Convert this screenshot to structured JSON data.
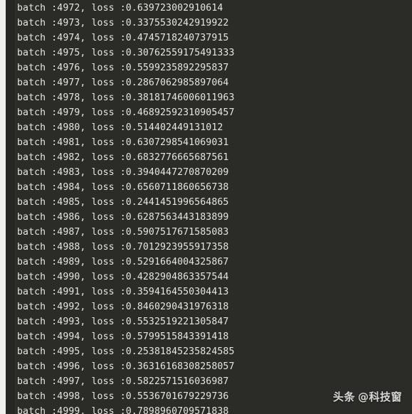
{
  "window": {
    "type": "terminal-console",
    "background_color": "#2b2b28",
    "text_color": "#e6e6e1",
    "margin_strip_color": "#f1f0ee",
    "gutter_color": "#262622"
  },
  "log": {
    "line_prefix": "batch :",
    "line_separator": ", loss :",
    "lines": [
      "batch :4972, loss :0.639723002910614",
      "batch :4973, loss :0.3375530242919922",
      "batch :4974, loss :0.4745718240737915",
      "batch :4975, loss :0.30762559175491333",
      "batch :4976, loss :0.5599235892295837",
      "batch :4977, loss :0.2867062985897064",
      "batch :4978, loss :0.38181746006011963",
      "batch :4979, loss :0.46892592310905457",
      "batch :4980, loss :0.514402449131012",
      "batch :4981, loss :0.6307298541069031",
      "batch :4982, loss :0.6832776665687561",
      "batch :4983, loss :0.3940447270870209",
      "batch :4984, loss :0.6560711860656738",
      "batch :4985, loss :0.2441451996564865",
      "batch :4986, loss :0.6287563443183899",
      "batch :4987, loss :0.5907517671585083",
      "batch :4988, loss :0.7012923955917358",
      "batch :4989, loss :0.5291664004325867",
      "batch :4990, loss :0.4282904863357544",
      "batch :4991, loss :0.3594164550304413",
      "batch :4992, loss :0.8460290431976318",
      "batch :4993, loss :0.5532519221305847",
      "batch :4994, loss :0.5799515843391418",
      "batch :4995, loss :0.25381845235824585",
      "batch :4996, loss :0.36316168308258057",
      "batch :4997, loss :0.5822571516036987",
      "batch :4998, loss :0.5536701679229736",
      "batch :4999, loss :0.7898960709571838"
    ],
    "entries": [
      {
        "batch": 4972,
        "loss": 0.639723002910614
      },
      {
        "batch": 4973,
        "loss": 0.3375530242919922
      },
      {
        "batch": 4974,
        "loss": 0.4745718240737915
      },
      {
        "batch": 4975,
        "loss": 0.30762559175491333
      },
      {
        "batch": 4976,
        "loss": 0.5599235892295837
      },
      {
        "batch": 4977,
        "loss": 0.2867062985897064
      },
      {
        "batch": 4978,
        "loss": 0.38181746006011963
      },
      {
        "batch": 4979,
        "loss": 0.46892592310905457
      },
      {
        "batch": 4980,
        "loss": 0.514402449131012
      },
      {
        "batch": 4981,
        "loss": 0.6307298541069031
      },
      {
        "batch": 4982,
        "loss": 0.6832776665687561
      },
      {
        "batch": 4983,
        "loss": 0.3940447270870209
      },
      {
        "batch": 4984,
        "loss": 0.6560711860656738
      },
      {
        "batch": 4985,
        "loss": 0.2441451996564865
      },
      {
        "batch": 4986,
        "loss": 0.6287563443183899
      },
      {
        "batch": 4987,
        "loss": 0.5907517671585083
      },
      {
        "batch": 4988,
        "loss": 0.7012923955917358
      },
      {
        "batch": 4989,
        "loss": 0.5291664004325867
      },
      {
        "batch": 4990,
        "loss": 0.4282904863357544
      },
      {
        "batch": 4991,
        "loss": 0.3594164550304413
      },
      {
        "batch": 4992,
        "loss": 0.8460290431976318
      },
      {
        "batch": 4993,
        "loss": 0.5532519221305847
      },
      {
        "batch": 4994,
        "loss": 0.5799515843391418
      },
      {
        "batch": 4995,
        "loss": 0.25381845235824585
      },
      {
        "batch": 4996,
        "loss": 0.36316168308258057
      },
      {
        "batch": 4997,
        "loss": 0.5822571516036987
      },
      {
        "batch": 4998,
        "loss": 0.5536701679229736
      },
      {
        "batch": 4999,
        "loss": 0.7898960709571838
      }
    ]
  },
  "watermark": {
    "brand": "头条",
    "handle": "@科技窗"
  }
}
